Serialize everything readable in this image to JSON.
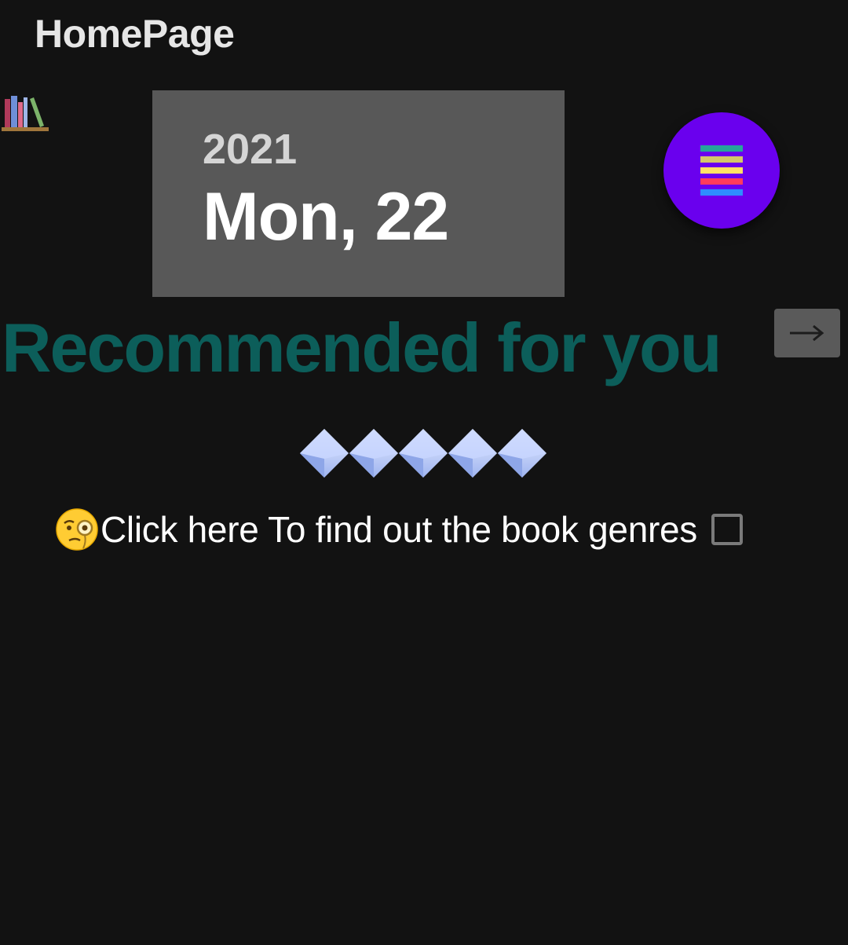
{
  "header": {
    "title": "HomePage"
  },
  "icons": {
    "books": "books-icon",
    "menu": "hamburger-menu-icon",
    "arrow": "arrow-right-icon",
    "rating": "diamond-icon",
    "genres_emoji": "face-with-monocle-icon"
  },
  "date_card": {
    "year": "2021",
    "day": "Mon, 22"
  },
  "recommended": {
    "heading": "Recommended for you",
    "rating_count": 5
  },
  "genres": {
    "label": "Click here To find out the book genres",
    "checked": false
  },
  "colors": {
    "background": "#121212",
    "card": "#585858",
    "fab": "#6a00ee",
    "heading": "#0c5e5a",
    "menu_bars": [
      "#26a69a",
      "#d4c76a",
      "#ffe066",
      "#ff3b5c",
      "#2f8cff"
    ]
  }
}
